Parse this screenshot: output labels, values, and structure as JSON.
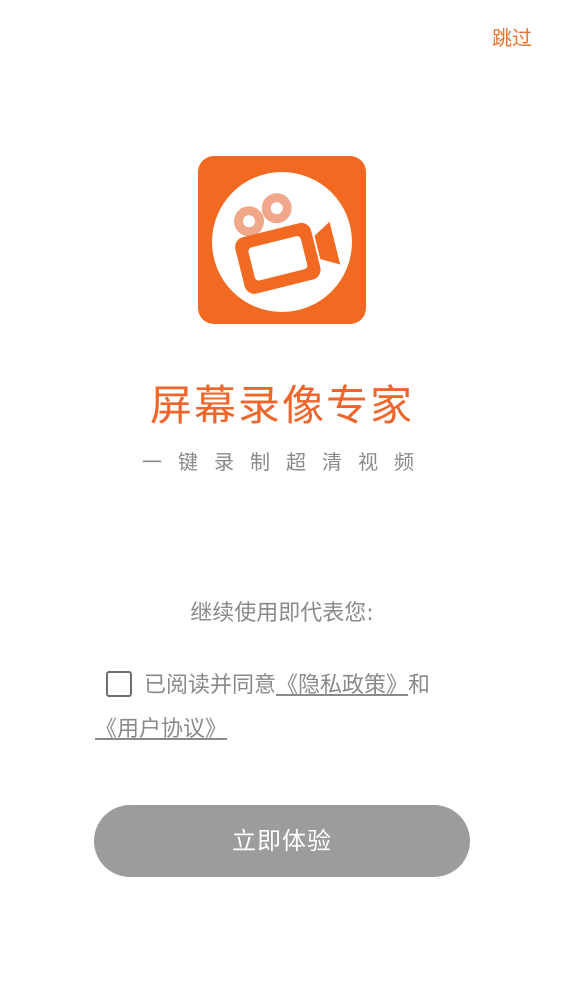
{
  "header": {
    "skip_label": "跳过"
  },
  "brand": {
    "icon": "video-camera-icon",
    "app_name": "屏幕录像专家",
    "slogan": "一键录制超清视频",
    "accent_color": "#f26a22"
  },
  "consent": {
    "continue_text": "继续使用即代表您:",
    "read_and_agree": "已阅读并同意",
    "privacy_policy": "《隐私政策》",
    "and": "和",
    "user_agreement": "《用户协议》"
  },
  "actions": {
    "start_label": "立即体验"
  }
}
